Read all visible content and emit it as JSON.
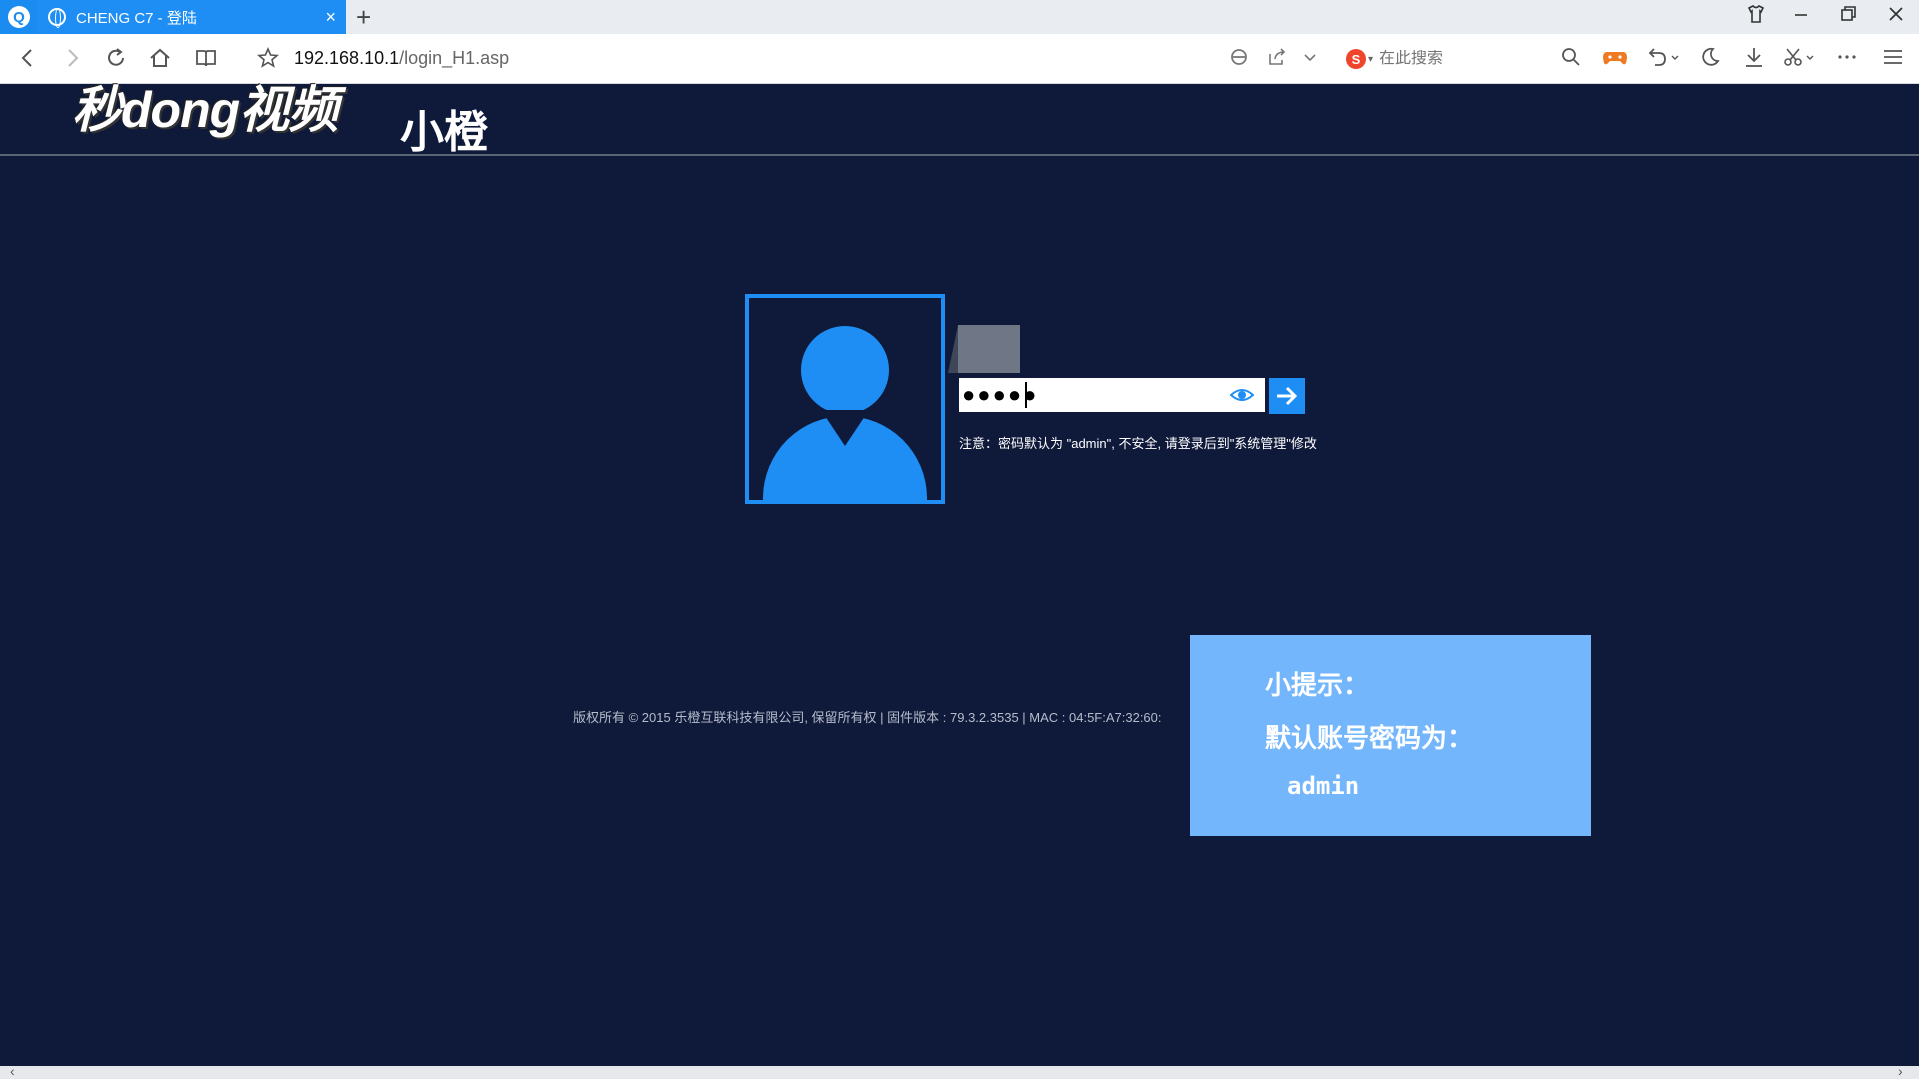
{
  "browser": {
    "tab_title": "CHENG C7 - 登陆",
    "tab_close": "×",
    "new_tab": "+",
    "url_host": "192.168.10.1",
    "url_path": "/login_H1.asp",
    "search_placeholder": "在此搜索",
    "search_engine_logo": "S"
  },
  "page": {
    "watermark": "秒dong视频",
    "brand": "小橙"
  },
  "login": {
    "password_value": "●●●●●",
    "note": "注意：密码默认为 \"admin\", 不安全, 请登录后到\"系统管理\"修改"
  },
  "footer": {
    "text": "版权所有 © 2015 乐橙互联科技有限公司, 保留所有权  |  固件版本 : 79.3.2.3535  |  MAC : 04:5F:A7:32:60:"
  },
  "tip": {
    "title": "小提示：",
    "line": "默认账号密码为：",
    "value": "admin"
  },
  "colors": {
    "page_bg": "#0f1a3a",
    "accent": "#1e8ef5",
    "tip_bg": "#74b6fb"
  }
}
